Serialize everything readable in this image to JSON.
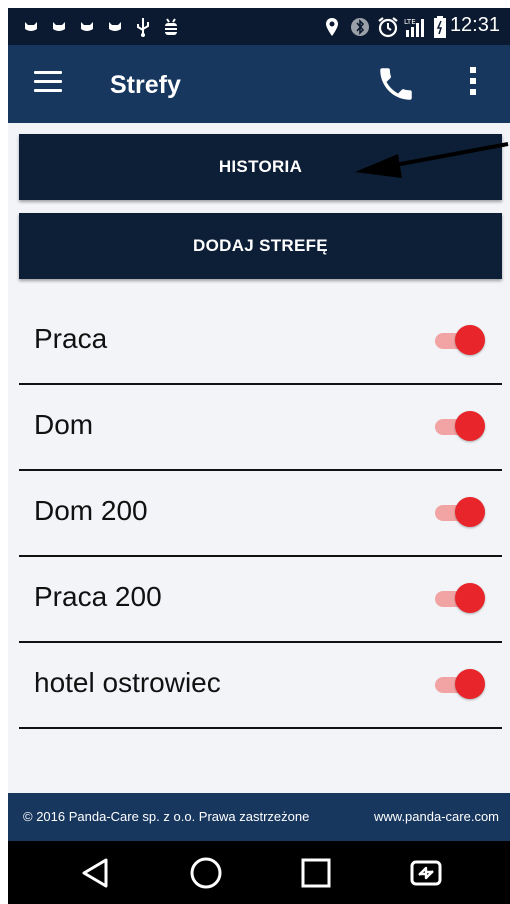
{
  "status_bar": {
    "time": "12:31",
    "network_label": "LTE",
    "left_icons": [
      "cat-notification-icon",
      "cat-notification-icon",
      "cat-notification-icon",
      "cat-notification-icon",
      "usb-icon",
      "android-debug-icon"
    ],
    "right_icons": [
      "location-pin-icon",
      "bluetooth-icon",
      "alarm-icon",
      "lte-signal-icon",
      "battery-icon"
    ]
  },
  "toolbar": {
    "title": "Strefy",
    "menu_icon": "hamburger-menu-icon",
    "call_icon": "phone-icon",
    "overflow_icon": "more-vertical-icon"
  },
  "actions": {
    "history_label": "HISTORIA",
    "add_zone_label": "DODAJ STREFĘ"
  },
  "zones": [
    {
      "name": "Praca",
      "enabled": true
    },
    {
      "name": "Dom",
      "enabled": true
    },
    {
      "name": "Dom 200",
      "enabled": true
    },
    {
      "name": "Praca 200",
      "enabled": true
    },
    {
      "name": "hotel ostrowiec",
      "enabled": true
    }
  ],
  "footer": {
    "copyright": "© 2016 Panda-Care sp. z o.o. Prawa zastrzeżone",
    "website": "www.panda-care.com"
  },
  "nav_bar": {
    "buttons": [
      "back-icon",
      "home-icon",
      "recents-icon",
      "screen-rotate-icon"
    ]
  },
  "colors": {
    "toolbar": "#17375f",
    "button": "#0d1f37",
    "toggle_thumb": "#e8252a",
    "toggle_track": "#f2a4a4",
    "background": "#f2f4f8"
  }
}
